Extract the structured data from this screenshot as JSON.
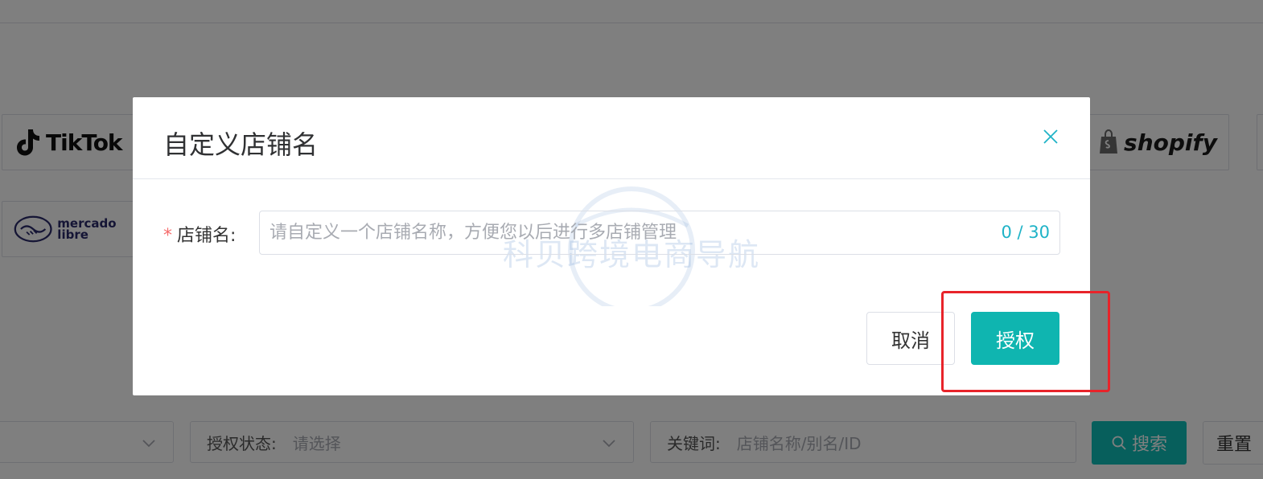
{
  "background": {
    "platforms": [
      {
        "name": "TikTok",
        "icon": "tiktok-logo-icon"
      },
      {
        "name": "mercado libre",
        "icon": "mercadolibre-handshake-icon"
      },
      {
        "name": "shopify",
        "icon": "shopify-bag-icon"
      }
    ],
    "filters": {
      "auth_status_label": "授权状态:",
      "auth_status_placeholder": "请选择",
      "keyword_label": "关键词:",
      "keyword_placeholder": "店铺名称/别名/ID",
      "search_button": "搜索",
      "reset_button": "重置"
    }
  },
  "dialog": {
    "title": "自定义店铺名",
    "close_icon": "close-icon",
    "field": {
      "label": "店铺名:",
      "required_mark": "*",
      "value": "",
      "placeholder": "请自定义一个店铺名称，方便您以后进行多店铺管理",
      "counter": "0 / 30"
    },
    "cancel_label": "取消",
    "authorize_label": "授权"
  },
  "watermark_text": "科贝跨境电商导航",
  "colors": {
    "accent": "#0fb5b0",
    "counter": "#1fb3c7",
    "highlight": "#e8232a",
    "required": "#f56c6c"
  }
}
